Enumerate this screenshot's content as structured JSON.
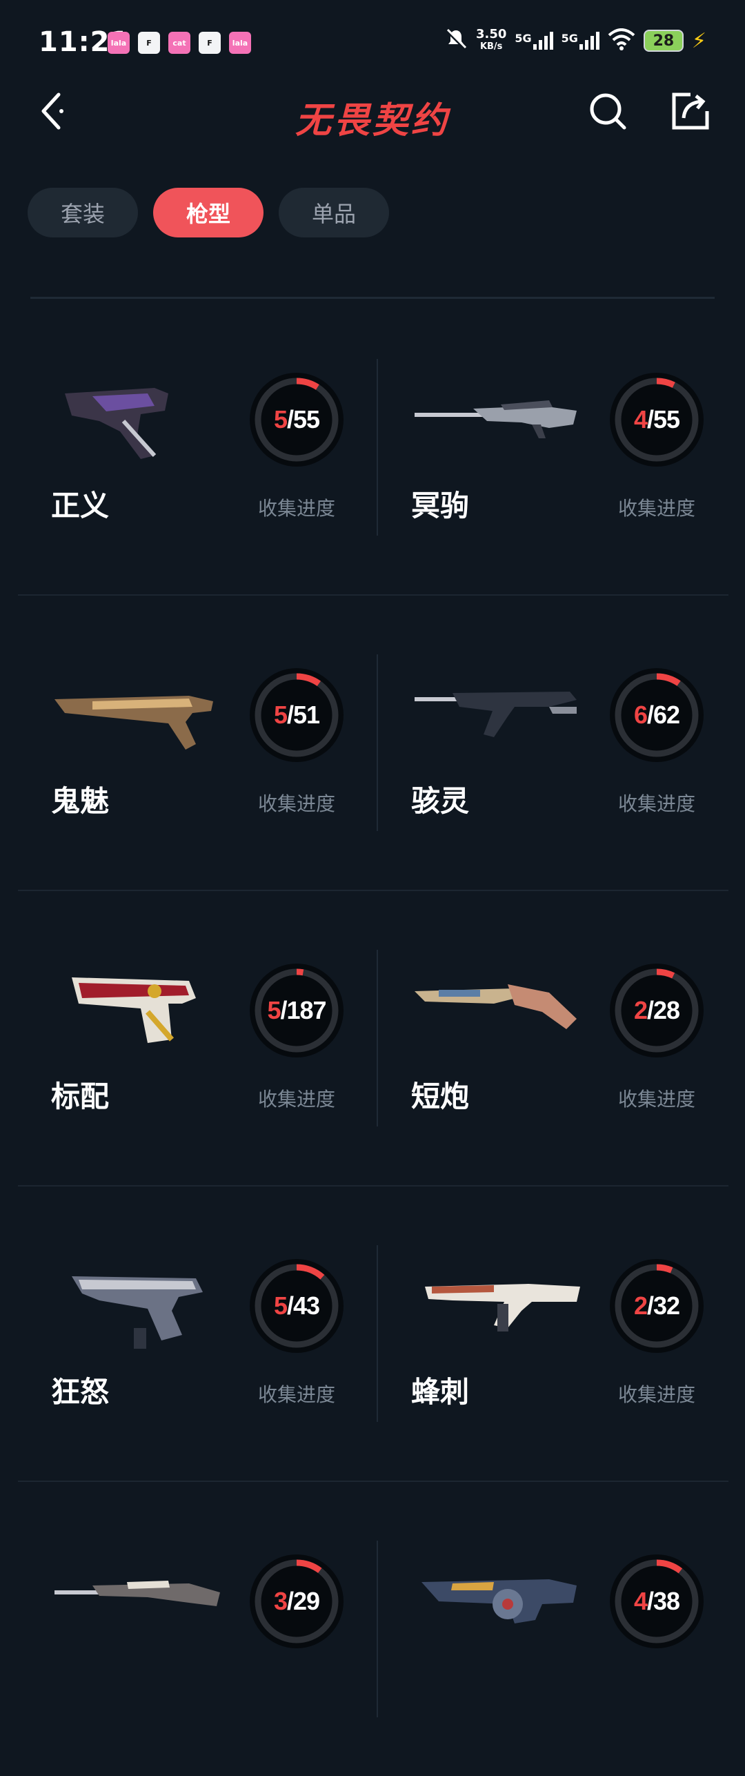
{
  "status_bar": {
    "time": "11:21",
    "notifications": [
      "lala",
      "F",
      "cat",
      "F",
      "lala"
    ],
    "speed_value": "3.50",
    "speed_unit": "KB/s",
    "net1": "5G",
    "net2": "5G",
    "battery": "28"
  },
  "header": {
    "title": "无畏契约"
  },
  "tabs": [
    {
      "label": "套装",
      "active": false
    },
    {
      "label": "枪型",
      "active": true
    },
    {
      "label": "单品",
      "active": false
    }
  ],
  "progress_label": "收集进度",
  "weapons": [
    {
      "name": "正义",
      "owned": "5",
      "total": "55",
      "fraction": 0.091,
      "gun": "revolver"
    },
    {
      "name": "冥驹",
      "owned": "4",
      "total": "55",
      "fraction": 0.073,
      "gun": "sniper"
    },
    {
      "name": "鬼魅",
      "owned": "5",
      "total": "51",
      "fraction": 0.098,
      "gun": "pistol"
    },
    {
      "name": "骇灵",
      "owned": "6",
      "total": "62",
      "fraction": 0.097,
      "gun": "smg"
    },
    {
      "name": "标配",
      "owned": "5",
      "total": "187",
      "fraction": 0.027,
      "gun": "classic"
    },
    {
      "name": "短炮",
      "owned": "2",
      "total": "28",
      "fraction": 0.071,
      "gun": "shotgun"
    },
    {
      "name": "狂怒",
      "owned": "5",
      "total": "43",
      "fraction": 0.116,
      "gun": "frenzy"
    },
    {
      "name": "蜂刺",
      "owned": "2",
      "total": "32",
      "fraction": 0.063,
      "gun": "stinger"
    },
    {
      "name": "",
      "owned": "3",
      "total": "29",
      "fraction": 0.103,
      "gun": "rifle"
    },
    {
      "name": "",
      "owned": "4",
      "total": "38",
      "fraction": 0.105,
      "gun": "heavy"
    }
  ],
  "colors": {
    "background": "#0f1720",
    "accent": "#f0545a",
    "progress_track": "#2b2f35",
    "progress_fill": "#ef4444"
  }
}
